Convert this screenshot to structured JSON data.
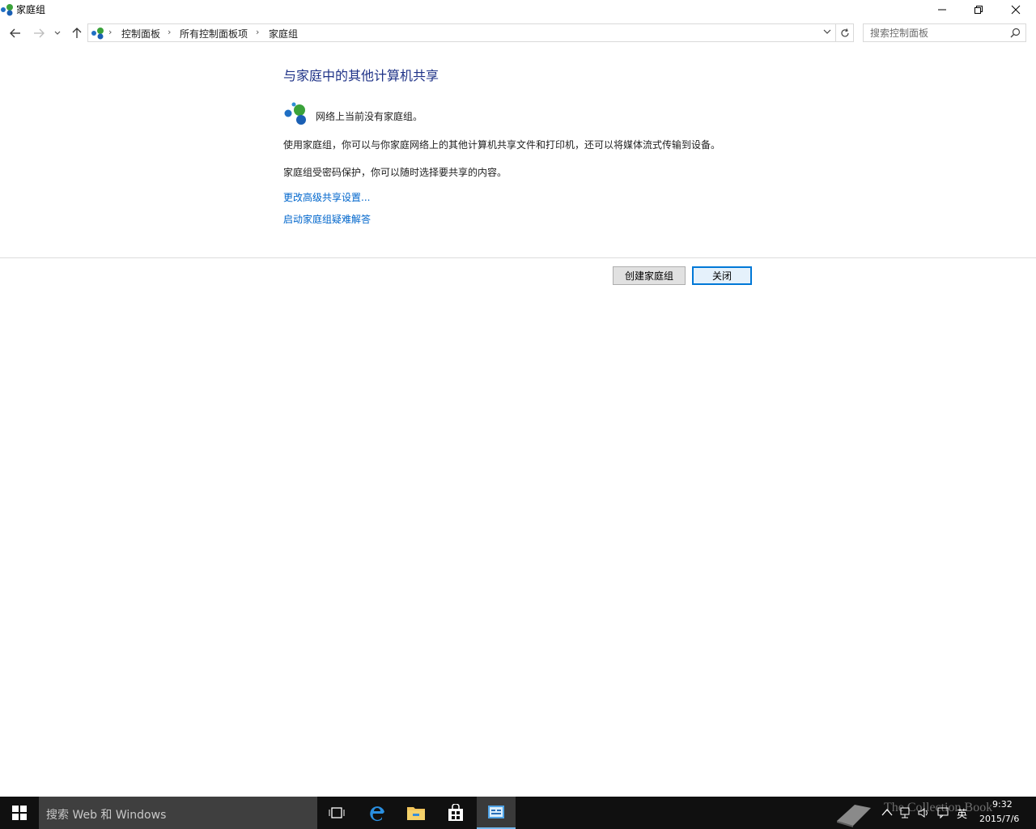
{
  "window": {
    "title": "家庭组"
  },
  "address": {
    "crumbs": [
      "控制面板",
      "所有控制面板项",
      "家庭组"
    ],
    "search_placeholder": "搜索控制面板"
  },
  "main": {
    "heading": "与家庭中的其他计算机共享",
    "status_text": "网络上当前没有家庭组。",
    "paragraph1": "使用家庭组，你可以与你家庭网络上的其他计算机共享文件和打印机，还可以将媒体流式传输到设备。",
    "paragraph2": "家庭组受密码保护，你可以随时选择要共享的内容。",
    "link_advanced": "更改高级共享设置...",
    "link_troubleshoot": "启动家庭组疑难解答"
  },
  "buttons": {
    "create": "创建家庭组",
    "close": "关闭"
  },
  "taskbar": {
    "search_text": "搜索 Web 和 Windows",
    "ime": "英",
    "time": "9:32",
    "date": "2015/7/6",
    "watermark": "The Collection Book"
  },
  "colors": {
    "heading": "#1e3287",
    "link": "#0066cc",
    "taskbar": "#101010",
    "accent": "#0078d7"
  }
}
